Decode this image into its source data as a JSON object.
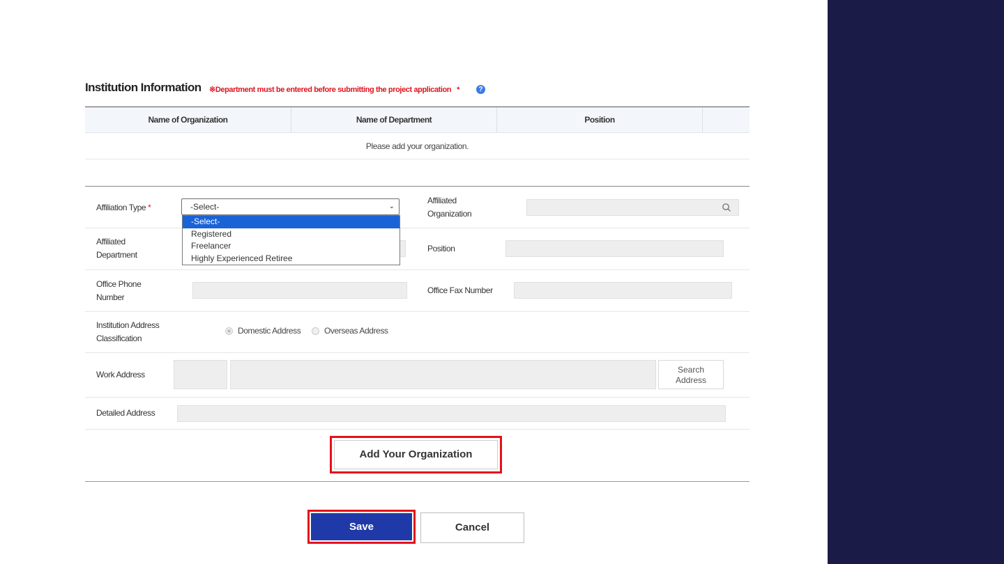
{
  "section": {
    "title": "Institution Information",
    "note": "※Department must be entered before submitting the project application",
    "required_mark": "*",
    "help_icon": "?"
  },
  "table": {
    "headers": [
      "Name of Organization",
      "Name of Department",
      "Position"
    ],
    "empty_message": "Please add your organization."
  },
  "form": {
    "affiliation_type": {
      "label": "Affiliation Type",
      "required": "*",
      "selected": "-Select-",
      "options": [
        "-Select-",
        "Registered",
        "Freelancer",
        "Highly Experienced Retiree"
      ]
    },
    "affiliated_organization": {
      "label_line1": "Affiliated",
      "label_line2": "Organization"
    },
    "affiliated_department": {
      "label_line1": "Affiliated",
      "label_line2": "Department"
    },
    "position": {
      "label": "Position"
    },
    "office_phone": {
      "label_line1": "Office Phone",
      "label_line2": "Number"
    },
    "office_fax": {
      "label": "Office Fax Number"
    },
    "address_classification": {
      "label_line1": "Institution Address",
      "label_line2": "Classification",
      "options": [
        "Domestic Address",
        "Overseas Address"
      ],
      "selected": "Domestic Address"
    },
    "work_address": {
      "label": "Work Address",
      "search_button_line1": "Search",
      "search_button_line2": "Address"
    },
    "detailed_address": {
      "label": "Detailed Address"
    }
  },
  "actions": {
    "add_organization": "Add Your Organization",
    "save": "Save",
    "cancel": "Cancel"
  },
  "colors": {
    "side_panel": "#1b1b47",
    "save_button": "#1f3aa8",
    "highlight_border": "#e5101a",
    "required": "#e0141e",
    "selected_option": "#1a63d6"
  }
}
